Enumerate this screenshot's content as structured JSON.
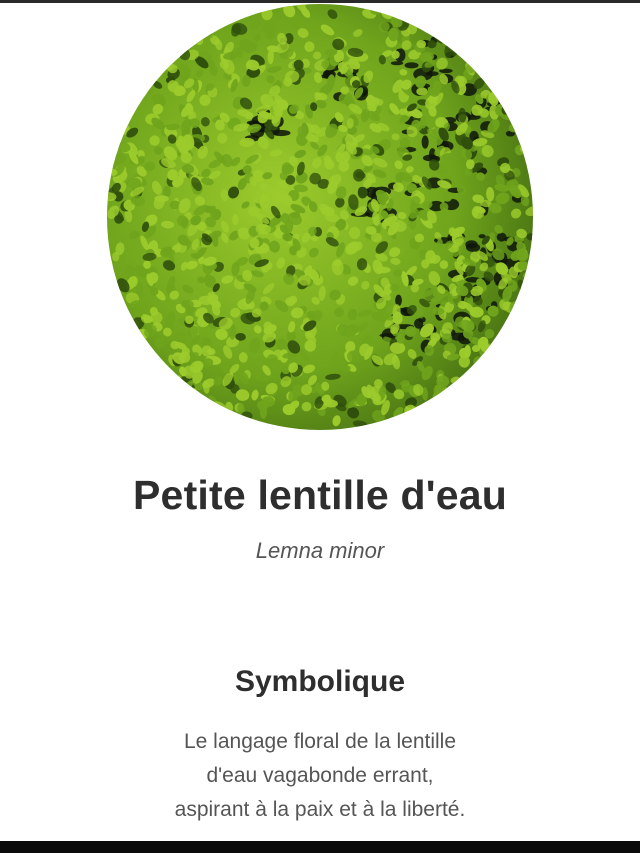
{
  "plant": {
    "image_icon": "duckweed-photo",
    "common_name": "Petite lentille d'eau",
    "scientific_name": "Lemna minor"
  },
  "symbolism": {
    "heading": "Symbolique",
    "lines": [
      "Le langage floral de la lentille",
      "d'eau vagabonde errant,",
      "aspirant à la paix et à la liberté."
    ]
  },
  "colors": {
    "leaf_light": "#9ccb2c",
    "leaf_mid": "#6fa41c",
    "leaf_dark": "#2f4f0c",
    "water": "#0e160a",
    "text_dark": "#2e2e2e",
    "text_muted": "#555555"
  }
}
